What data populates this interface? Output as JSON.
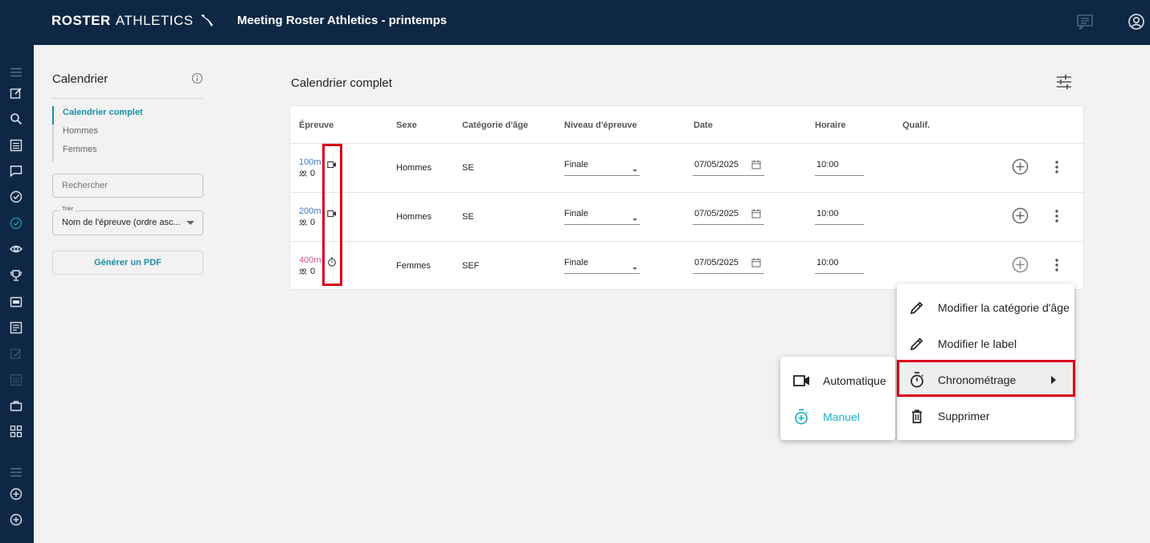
{
  "header": {
    "brand_bold": "ROSTER",
    "brand_light": "ATHLETICS",
    "title": "Meeting Roster Athletics - printemps",
    "icons": [
      "chat-icon",
      "account-icon"
    ]
  },
  "rail": {
    "icons": [
      "menu-icon",
      "edit-icon",
      "search-icon",
      "list-icon",
      "message-icon",
      "check-circle-icon",
      "timer-check-icon",
      "eye-icon",
      "trophy-icon",
      "bib-icon",
      "document-icon",
      "edit-check-icon",
      "list-disabled-icon",
      "briefcase-icon",
      "grid-icon",
      "menu-icon",
      "add-circle-icon",
      "add-circle-icon"
    ]
  },
  "sidebar": {
    "title": "Calendrier",
    "nav": [
      {
        "label": "Calendrier complet",
        "active": true
      },
      {
        "label": "Hommes",
        "active": false
      },
      {
        "label": "Femmes",
        "active": false
      }
    ],
    "search_placeholder": "Rechercher",
    "sort_label": "Trier",
    "sort_value": "Nom de l'épreuve (ordre asc...",
    "pdf_button": "Générer un PDF"
  },
  "main": {
    "title": "Calendrier complet",
    "columns": [
      "Épreuve",
      "Sexe",
      "Catégorie d'âge",
      "Niveau d'épreuve",
      "Date",
      "Horaire",
      "Qualif."
    ],
    "rows": [
      {
        "event": "100m",
        "event_color": "#3a7bbf",
        "participants": "0",
        "timing_icon": "video-camera-icon",
        "sex": "Hommes",
        "category": "SE",
        "level": "Finale",
        "date": "07/05/2025",
        "time": "10:00"
      },
      {
        "event": "200m",
        "event_color": "#3a7bbf",
        "participants": "0",
        "timing_icon": "video-camera-icon",
        "sex": "Hommes",
        "category": "SE",
        "level": "Finale",
        "date": "07/05/2025",
        "time": "10:00"
      },
      {
        "event": "400m",
        "event_color": "#d0568a",
        "participants": "0",
        "timing_icon": "stopwatch-icon",
        "sex": "Femmes",
        "category": "SEF",
        "level": "Finale",
        "date": "07/05/2025",
        "time": "10:00"
      }
    ]
  },
  "context_menu": {
    "items": [
      {
        "label": "Modifier la catégorie d'âge",
        "icon": "pencil-icon"
      },
      {
        "label": "Modifier le label",
        "icon": "pencil-icon"
      },
      {
        "label": "Chronométrage",
        "icon": "stopwatch-icon",
        "submenu": true,
        "highlighted": true
      },
      {
        "label": "Supprimer",
        "icon": "trash-icon"
      }
    ]
  },
  "submenu": {
    "items": [
      {
        "label": "Automatique",
        "icon": "video-camera-icon",
        "selected": false
      },
      {
        "label": "Manuel",
        "icon": "stopwatch-icon",
        "selected": true
      }
    ]
  },
  "colors": {
    "navy": "#0e2744",
    "accent": "#1a8fa6",
    "highlight": "#d9001b",
    "men_event": "#3a7bbf",
    "women_event": "#d0568a"
  }
}
